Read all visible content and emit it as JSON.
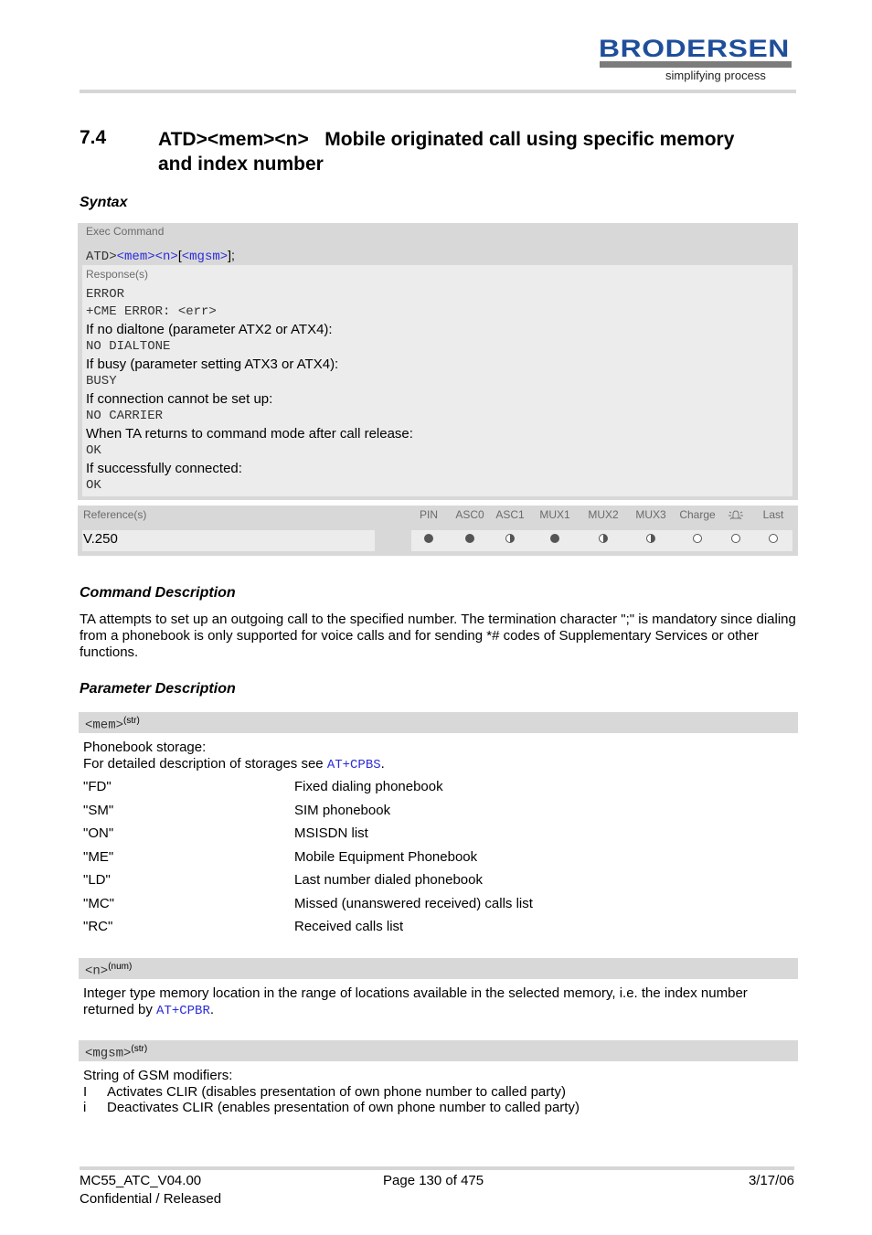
{
  "header": {
    "logo_text": "BRODERSEN",
    "logo_tagline": "simplifying process",
    "brand_color": "#1f4e9a"
  },
  "section": {
    "number": "7.4",
    "title_line1": "ATD><mem><n>   Mobile originated call using specific memory",
    "title_line2": "and index number"
  },
  "syntax": {
    "label": "Syntax",
    "exec_label": "Exec Command",
    "command_prefix": "ATD>",
    "command_param1": "<mem>",
    "command_param2": "<n>",
    "command_bracket_open": "[",
    "command_param3": "<mgsm>",
    "command_suffix": "];",
    "response_label": "Response(s)",
    "responses": [
      {
        "text": "ERROR",
        "mono": true
      },
      {
        "text": "+CME ERROR: <err>",
        "mono": true
      },
      {
        "text": "If no dialtone (parameter ATX2 or ATX4):",
        "mono": false
      },
      {
        "text": "NO DIALTONE",
        "mono": true
      },
      {
        "text": "If busy (parameter setting ATX3 or ATX4):",
        "mono": false
      },
      {
        "text": "BUSY",
        "mono": true
      },
      {
        "text": "If connection cannot be set up:",
        "mono": false
      },
      {
        "text": "NO CARRIER",
        "mono": true
      },
      {
        "text": "When TA returns to command mode after call release:",
        "mono": false
      },
      {
        "text": "OK",
        "mono": true
      },
      {
        "text": "If successfully connected:",
        "mono": false
      },
      {
        "text": "OK",
        "mono": true
      }
    ],
    "reference_label": "Reference(s)",
    "reference_value": "V.250",
    "columns": [
      {
        "label": "PIN",
        "state": "full"
      },
      {
        "label": "ASC0",
        "state": "full"
      },
      {
        "label": "ASC1",
        "state": "half"
      },
      {
        "label": "MUX1",
        "state": "full"
      },
      {
        "label": "MUX2",
        "state": "half"
      },
      {
        "label": "MUX3",
        "state": "half"
      },
      {
        "label": "Charge",
        "state": "empty"
      },
      {
        "label": "alarm-icon",
        "state": "empty"
      },
      {
        "label": "Last",
        "state": "empty"
      }
    ]
  },
  "command_description": {
    "label": "Command Description",
    "text": "TA attempts to set up an outgoing call to the specified number. The termination character \";\" is mandatory since dialing from a phonebook is only supported for voice calls and for sending *# codes of Supplementary Services or other functions."
  },
  "parameter_description": {
    "label": "Parameter Description",
    "mem": {
      "name": "<mem>",
      "type": "(str)",
      "intro": "Phonebook storage:",
      "detail_prefix": "For detailed description of storages see ",
      "detail_link": "AT+CPBS",
      "detail_suffix": ".",
      "values": [
        {
          "key": "\"FD\"",
          "desc": "Fixed dialing phonebook"
        },
        {
          "key": "\"SM\"",
          "desc": "SIM phonebook"
        },
        {
          "key": "\"ON\"",
          "desc": "MSISDN list"
        },
        {
          "key": "\"ME\"",
          "desc": "Mobile Equipment Phonebook"
        },
        {
          "key": "\"LD\"",
          "desc": "Last number dialed phonebook"
        },
        {
          "key": "\"MC\"",
          "desc": "Missed (unanswered received) calls list"
        },
        {
          "key": "\"RC\"",
          "desc": "Received calls list"
        }
      ]
    },
    "n": {
      "name": "<n>",
      "type": "(num)",
      "text_line1": "Integer type memory location in the range of locations available in the selected memory, i.e. the index number",
      "text_line2_prefix": "returned by ",
      "text_link": "AT+CPBR",
      "text_suffix": "."
    },
    "mgsm": {
      "name": "<mgsm>",
      "type": "(str)",
      "intro": "String of GSM modifiers:",
      "items": [
        {
          "key": "I",
          "desc": "Activates CLIR (disables presentation of own phone number to called party)"
        },
        {
          "key": "i",
          "desc": "Deactivates CLIR (enables presentation of own phone number to called party)"
        }
      ]
    }
  },
  "footer": {
    "doc_id": "MC55_ATC_V04.00",
    "page": "Page 130 of 475",
    "date": "3/17/06",
    "status": "Confidential / Released"
  }
}
